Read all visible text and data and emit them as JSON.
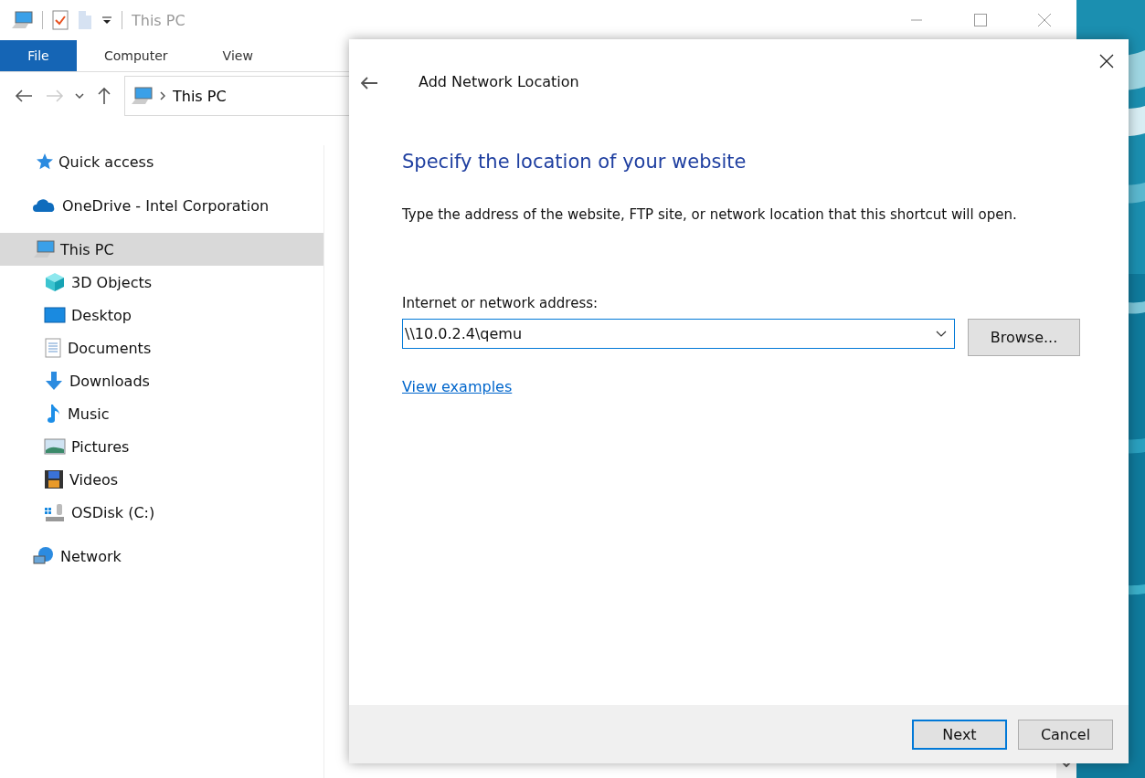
{
  "explorer": {
    "title": "This PC",
    "ribbon_tabs": [
      {
        "label": "File",
        "selected": true
      },
      {
        "label": "Computer",
        "selected": false
      },
      {
        "label": "View",
        "selected": false
      }
    ],
    "address": {
      "path": "This PC"
    },
    "nav_items": [
      {
        "label": "Quick access",
        "kind": "star",
        "selected": false
      },
      {
        "label": "OneDrive - Intel Corporation",
        "kind": "cloud",
        "selected": false
      },
      {
        "label": "This PC",
        "kind": "pc",
        "selected": true,
        "children": [
          {
            "label": "3D Objects",
            "kind": "cube",
            "selected": false
          },
          {
            "label": "Desktop",
            "kind": "desktop",
            "selected": false
          },
          {
            "label": "Documents",
            "kind": "document",
            "selected": false
          },
          {
            "label": "Downloads",
            "kind": "download",
            "selected": false
          },
          {
            "label": "Music",
            "kind": "music",
            "selected": false
          },
          {
            "label": "Pictures",
            "kind": "pictures",
            "selected": false
          },
          {
            "label": "Videos",
            "kind": "video",
            "selected": false
          },
          {
            "label": "OSDisk (C:)",
            "kind": "disk",
            "selected": false
          }
        ]
      },
      {
        "label": "Network",
        "kind": "network",
        "selected": false
      }
    ]
  },
  "dialog": {
    "title": "Add Network Location",
    "heading": "Specify the location of your website",
    "description": "Type the address of the website, FTP site, or network location that this shortcut will open.",
    "address_label": "Internet or network address:",
    "address_value": "\\\\10.0.2.4\\qemu",
    "browse_button": "Browse...",
    "link": "View examples",
    "footer_buttons": [
      {
        "label": "Next",
        "default": true
      },
      {
        "label": "Cancel",
        "default": false
      }
    ]
  }
}
